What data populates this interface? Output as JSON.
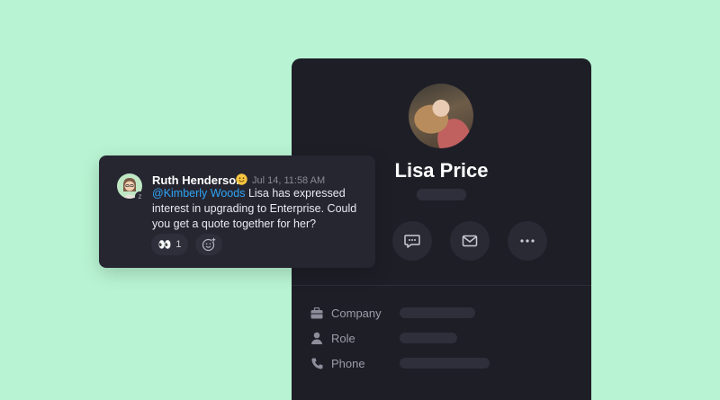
{
  "contact": {
    "name": "Lisa Price",
    "actions": [
      {
        "icon": "chat-icon"
      },
      {
        "icon": "mail-icon"
      },
      {
        "icon": "more-icon"
      }
    ],
    "fields": [
      {
        "label": "Company",
        "icon": "briefcase-icon"
      },
      {
        "label": "Role",
        "icon": "person-icon"
      },
      {
        "label": "Phone",
        "icon": "phone-icon"
      }
    ]
  },
  "comment": {
    "author": "Ruth Henderson",
    "author_emoji": "smile-emoji",
    "timestamp": "Jul 14, 11:58 AM",
    "mention": "@Kimberly Woods",
    "text": " Lisa has expressed interest in upgrading to Enterprise. Could you get a quote together for her?",
    "reaction": {
      "emoji": "👀",
      "count": "1"
    },
    "away_indicator": "z"
  },
  "colors": {
    "background": "#b8f4d3",
    "panel": "#1e1e27",
    "card": "#262631",
    "mention": "#2fa4f5"
  }
}
